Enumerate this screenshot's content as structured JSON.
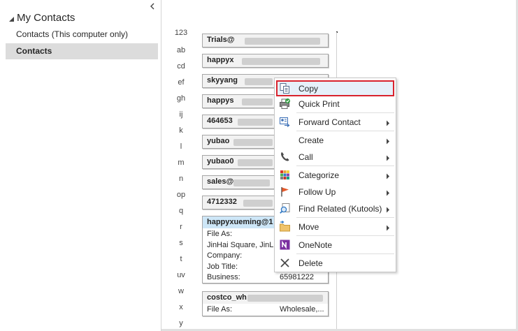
{
  "folder_pane": {
    "group_title": "My Contacts",
    "items": [
      {
        "label": "Contacts (This computer only)",
        "selected": false
      },
      {
        "label": "Contacts",
        "selected": true
      }
    ]
  },
  "alphabet_index": [
    "123",
    "ab",
    "cd",
    "ef",
    "gh",
    "ij",
    "k",
    "l",
    "m",
    "n",
    "op",
    "q",
    "r",
    "s",
    "t",
    "uv",
    "w",
    "x",
    "y"
  ],
  "contact_cards": [
    {
      "name": "Trials@"
    },
    {
      "name": "happyx"
    },
    {
      "name": "skyyang"
    },
    {
      "name": "happys"
    },
    {
      "name": "464653"
    },
    {
      "name": "yubao"
    },
    {
      "name": "yubao0"
    },
    {
      "name": "sales@"
    },
    {
      "name": "4712332"
    }
  ],
  "expanded_card": {
    "name": "happyxueming@1",
    "fields": [
      {
        "label": "File As:",
        "value": ""
      },
      {
        "label": "JinHai Square, JinL",
        "value": ""
      },
      {
        "label": "Company:",
        "value": ""
      },
      {
        "label": "Job Title:",
        "value": ""
      },
      {
        "label": "Business:",
        "value": "65981222"
      }
    ]
  },
  "costco_card": {
    "name": "costco_wh",
    "field_label": "File As:",
    "field_value": "Wholesale,..."
  },
  "context_menu": {
    "items": [
      {
        "label": "Copy",
        "icon": "copy-icon",
        "submenu": false,
        "highlighted": true
      },
      {
        "label": "Quick Print",
        "icon": "printer-icon",
        "submenu": false
      },
      {
        "label": "Forward Contact",
        "icon": "forward-contact-icon",
        "submenu": true
      },
      {
        "label": "Create",
        "icon": "",
        "submenu": true
      },
      {
        "label": "Call",
        "icon": "phone-icon",
        "submenu": true
      },
      {
        "label": "Categorize",
        "icon": "categorize-icon",
        "submenu": true
      },
      {
        "label": "Follow Up",
        "icon": "flag-icon",
        "submenu": true
      },
      {
        "label": "Find Related (Kutools)",
        "icon": "search-icon",
        "submenu": true
      },
      {
        "label": "Move",
        "icon": "folder-move-icon",
        "submenu": true
      },
      {
        "label": "OneNote",
        "icon": "onenote-icon",
        "submenu": false
      },
      {
        "label": "Delete",
        "icon": "delete-icon",
        "submenu": false
      }
    ]
  },
  "colors": {
    "selected_folder_bg": "#dcdcdc",
    "expanded_card_header": "#cde6f7",
    "highlight_border": "#d9232d"
  }
}
